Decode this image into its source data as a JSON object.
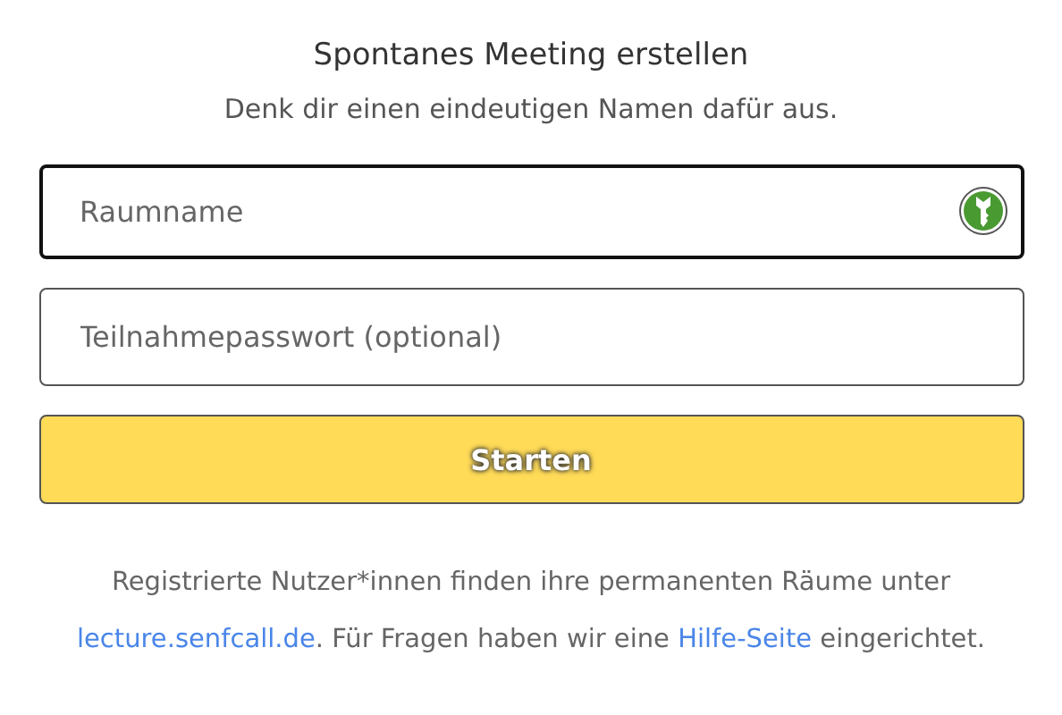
{
  "title": "Spontanes Meeting erstellen",
  "subtitle": "Denk dir einen eindeutigen Namen dafür aus.",
  "fields": [
    {
      "placeholder": "Raumname",
      "focused": true,
      "kind": "password-manager"
    },
    {
      "placeholder": "Teilnahmepasswort (optional)",
      "focused": false,
      "kind": "plain"
    }
  ],
  "button": "Starten",
  "footer": [
    {
      "kind": "text",
      "text": "Registrierte Nutzer*innen finden ihre permanenten Räume unter "
    },
    {
      "kind": "link",
      "text": "lecture.senfcall.de"
    },
    {
      "kind": "text",
      "text": ". Für Fragen haben wir eine "
    },
    {
      "kind": "link",
      "text": "Hilfe-Seite"
    },
    {
      "kind": "text",
      "text": " eingerichtet."
    }
  ]
}
